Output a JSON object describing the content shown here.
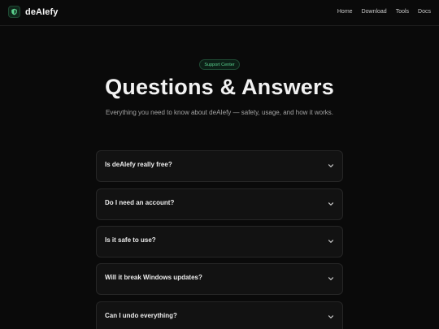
{
  "header": {
    "brand": "deAIefy",
    "nav": [
      "Home",
      "Download",
      "Tools",
      "Docs"
    ]
  },
  "hero": {
    "badge": "Support Center",
    "title": "Questions & Answers",
    "subtitle": "Everything you need to know about deAIefy — safety, usage, and how it works."
  },
  "faq": {
    "items": [
      {
        "question": "Is deAIefy really free?"
      },
      {
        "question": "Do I need an account?"
      },
      {
        "question": "Is it safe to use?"
      },
      {
        "question": "Will it break Windows updates?"
      },
      {
        "question": "Can I undo everything?"
      }
    ]
  },
  "colors": {
    "background": "#0a0a0a",
    "accent": "#5cd390",
    "card": "#121212"
  }
}
